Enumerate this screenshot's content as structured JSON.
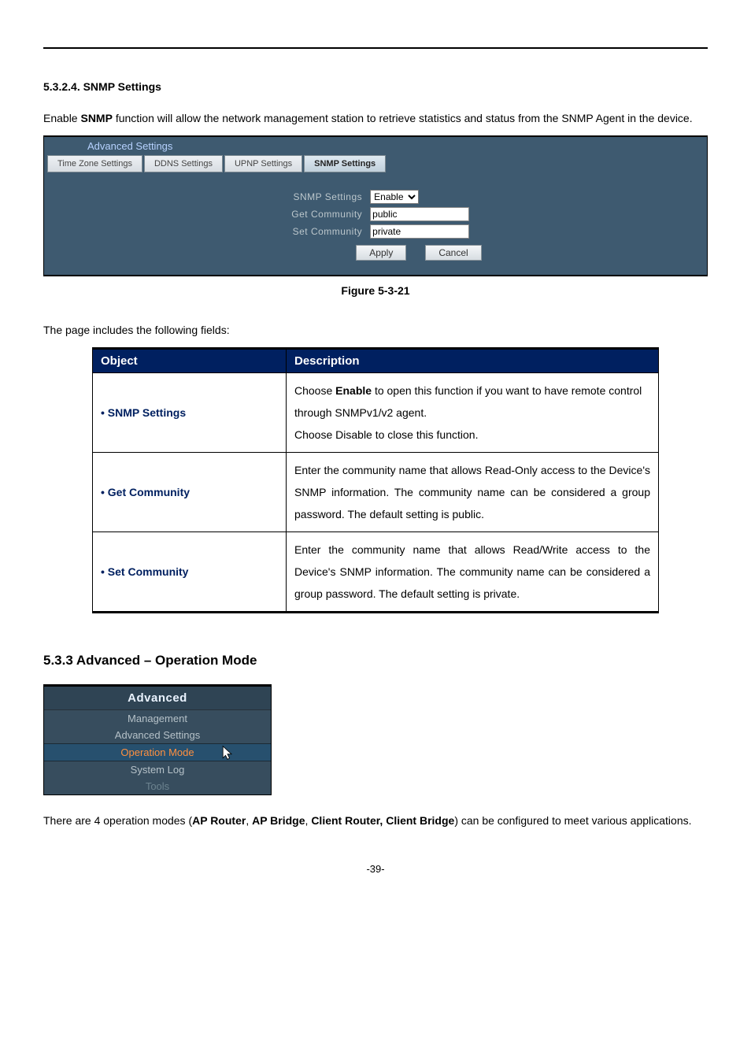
{
  "section1": {
    "heading_num": "5.3.2.4.",
    "heading_text": "SNMP Settings",
    "intro_before": "Enable ",
    "intro_bold": "SNMP",
    "intro_after": " function will allow the network management station to retrieve statistics and status from the SNMP Agent in the device."
  },
  "adv_panel": {
    "title": "Advanced Settings",
    "tabs": [
      "Time Zone Settings",
      "DDNS Settings",
      "UPNP Settings",
      "SNMP Settings"
    ],
    "active_tab": "SNMP Settings",
    "rows": {
      "snmp_label": "SNMP Settings",
      "snmp_value": "Enable",
      "get_label": "Get Community",
      "get_value": "public",
      "set_label": "Set Community",
      "set_value": "private"
    },
    "buttons": {
      "apply": "Apply",
      "cancel": "Cancel"
    },
    "caption": "Figure 5-3-21"
  },
  "fields_intro": "The page includes the following fields:",
  "table": {
    "headers": {
      "object": "Object",
      "description": "Description"
    },
    "rows": [
      {
        "object": "SNMP Settings",
        "desc_before": "Choose ",
        "desc_bold": "Enable",
        "desc_after": " to open this function if you want to have remote control through SNMPv1/v2 agent.\nChoose Disable to close this function."
      },
      {
        "object": "Get Community",
        "desc": "Enter the community name that allows Read-Only access to the Device's SNMP information. The community name can be considered a group password. The default setting is public."
      },
      {
        "object": "Set Community",
        "desc": "Enter the community name that allows Read/Write access to the Device's SNMP information. The community name can be considered a group password. The default setting is private."
      }
    ]
  },
  "section2": {
    "heading": "5.3.3  Advanced – Operation Mode",
    "menu_header": "Advanced",
    "menu_items": [
      "Management",
      "Advanced Settings",
      "Operation Mode",
      "System Log",
      "Tools"
    ],
    "active_item": "Operation Mode",
    "text_before": "There are 4 operation modes (",
    "b1": "AP Router",
    "sep1": ", ",
    "b2": "AP Bridge",
    "sep2": ", ",
    "b3": "Client Router, Client Bridge",
    "text_after": ") can be configured to meet various applications."
  },
  "page_num": "-39-"
}
